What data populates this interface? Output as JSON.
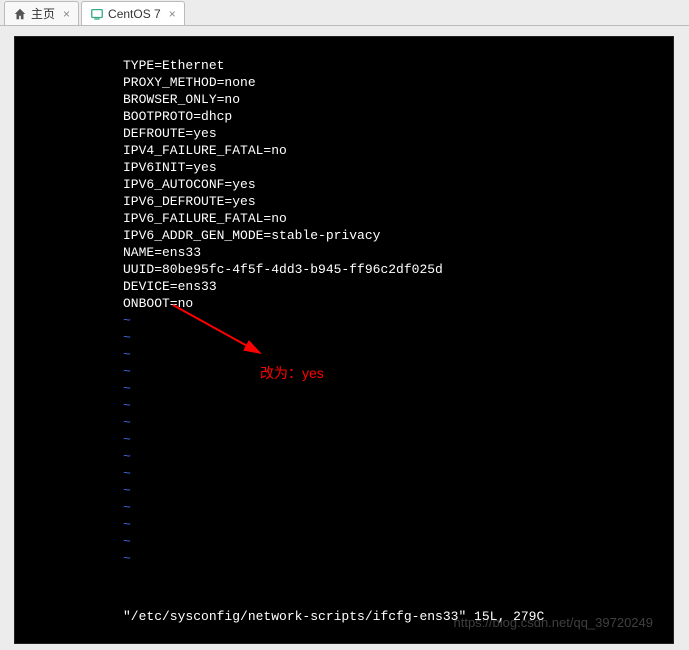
{
  "tabs": [
    {
      "label": "主页",
      "kind": "home"
    },
    {
      "label": "CentOS 7",
      "kind": "vm"
    }
  ],
  "config_lines": [
    "TYPE=Ethernet",
    "PROXY_METHOD=none",
    "BROWSER_ONLY=no",
    "BOOTPROTO=dhcp",
    "DEFROUTE=yes",
    "IPV4_FAILURE_FATAL=no",
    "IPV6INIT=yes",
    "IPV6_AUTOCONF=yes",
    "IPV6_DEFROUTE=yes",
    "IPV6_FAILURE_FATAL=no",
    "IPV6_ADDR_GEN_MODE=stable-privacy",
    "NAME=ens33",
    "UUID=80be95fc-4f5f-4dd3-b945-ff96c2df025d",
    "DEVICE=ens33",
    "ONBOOT=no"
  ],
  "tilde_count": 15,
  "status_line": "\"/etc/sysconfig/network-scripts/ifcfg-ens33\" 15L, 279C",
  "annotation": {
    "text": "改为：yes"
  },
  "watermark": "https://blog.csdn.net/qq_39720249",
  "colors": {
    "tilde": "#4169e1",
    "annotation": "#ff0000"
  }
}
